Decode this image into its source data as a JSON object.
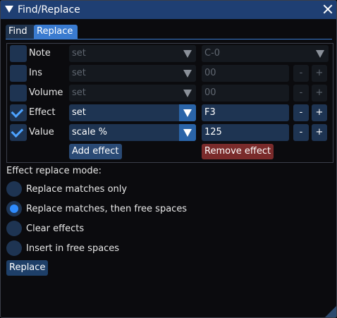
{
  "window": {
    "title": "Find/Replace"
  },
  "tabs": [
    {
      "label": "Find",
      "active": false
    },
    {
      "label": "Replace",
      "active": true
    }
  ],
  "rows": [
    {
      "label": "Note",
      "checked": false,
      "mode": "set",
      "value": "C-0",
      "value_kind": "combo",
      "enabled": false
    },
    {
      "label": "Ins",
      "checked": false,
      "mode": "set",
      "value": "00",
      "value_kind": "stepper",
      "enabled": false
    },
    {
      "label": "Volume",
      "checked": false,
      "mode": "set",
      "value": "00",
      "value_kind": "stepper",
      "enabled": false
    },
    {
      "label": "Effect",
      "checked": true,
      "mode": "set",
      "value": "F3",
      "value_kind": "stepper",
      "enabled": true
    },
    {
      "label": "Value",
      "checked": true,
      "mode": "scale %",
      "value": "125",
      "value_kind": "stepper",
      "enabled": true
    }
  ],
  "stepper": {
    "minus": "-",
    "plus": "+"
  },
  "actions": {
    "add_effect": "Add effect",
    "remove_effect": "Remove effect"
  },
  "effect_mode": {
    "label": "Effect replace mode:",
    "options": [
      {
        "label": "Replace matches only",
        "selected": false
      },
      {
        "label": "Replace matches, then free spaces",
        "selected": true
      },
      {
        "label": "Clear effects",
        "selected": false
      },
      {
        "label": "Insert in free spaces",
        "selected": false
      }
    ]
  },
  "replace_button": "Replace",
  "colors": {
    "accent": "#3a7bd0",
    "title_bar": "#1f3f73",
    "danger": "#7a2b2b",
    "radio_on": "#2f8cff"
  }
}
